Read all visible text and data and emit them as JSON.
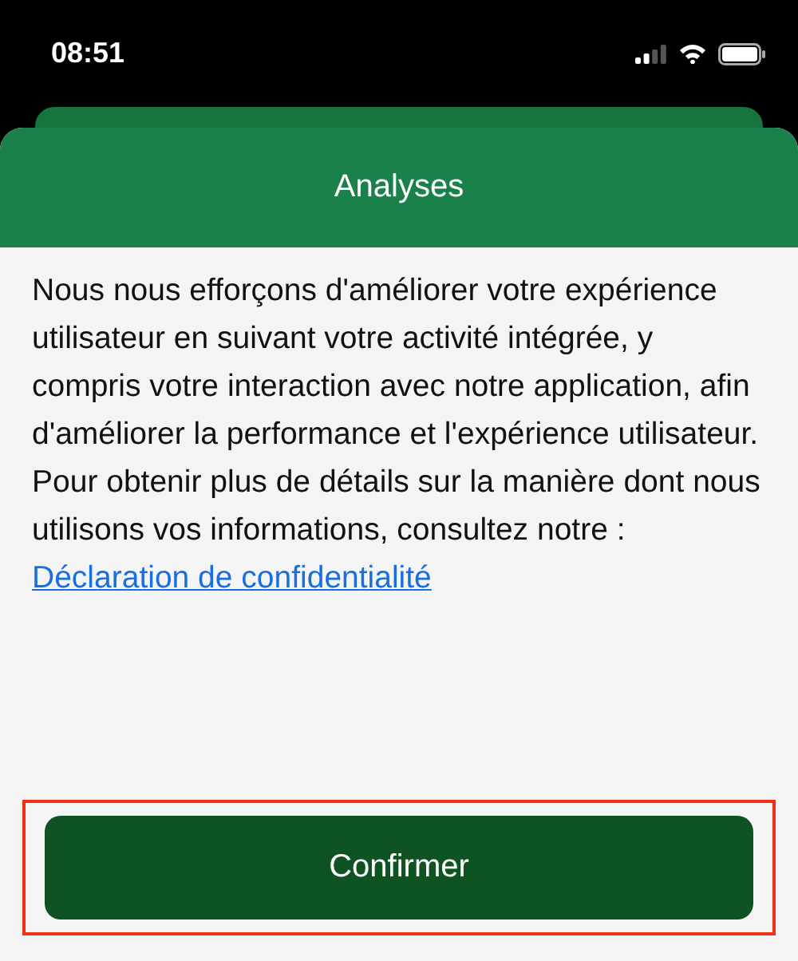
{
  "status_bar": {
    "time": "08:51"
  },
  "sheet": {
    "title": "Analyses"
  },
  "body": {
    "paragraphs": [
      "Nous nous efforçons d'améliorer votre expérience utilisateur en suivant votre activité intégrée, y compris votre interaction avec notre application, afin d'améliorer la performance et l'expérience utilisateur.",
      "Pour obtenir plus de détails sur la manière dont nous utilisons vos informations, consultez notre :"
    ],
    "link": "Déclaration de confidentialité"
  },
  "button": {
    "label": "Confirmer",
    "highlighted": true
  }
}
